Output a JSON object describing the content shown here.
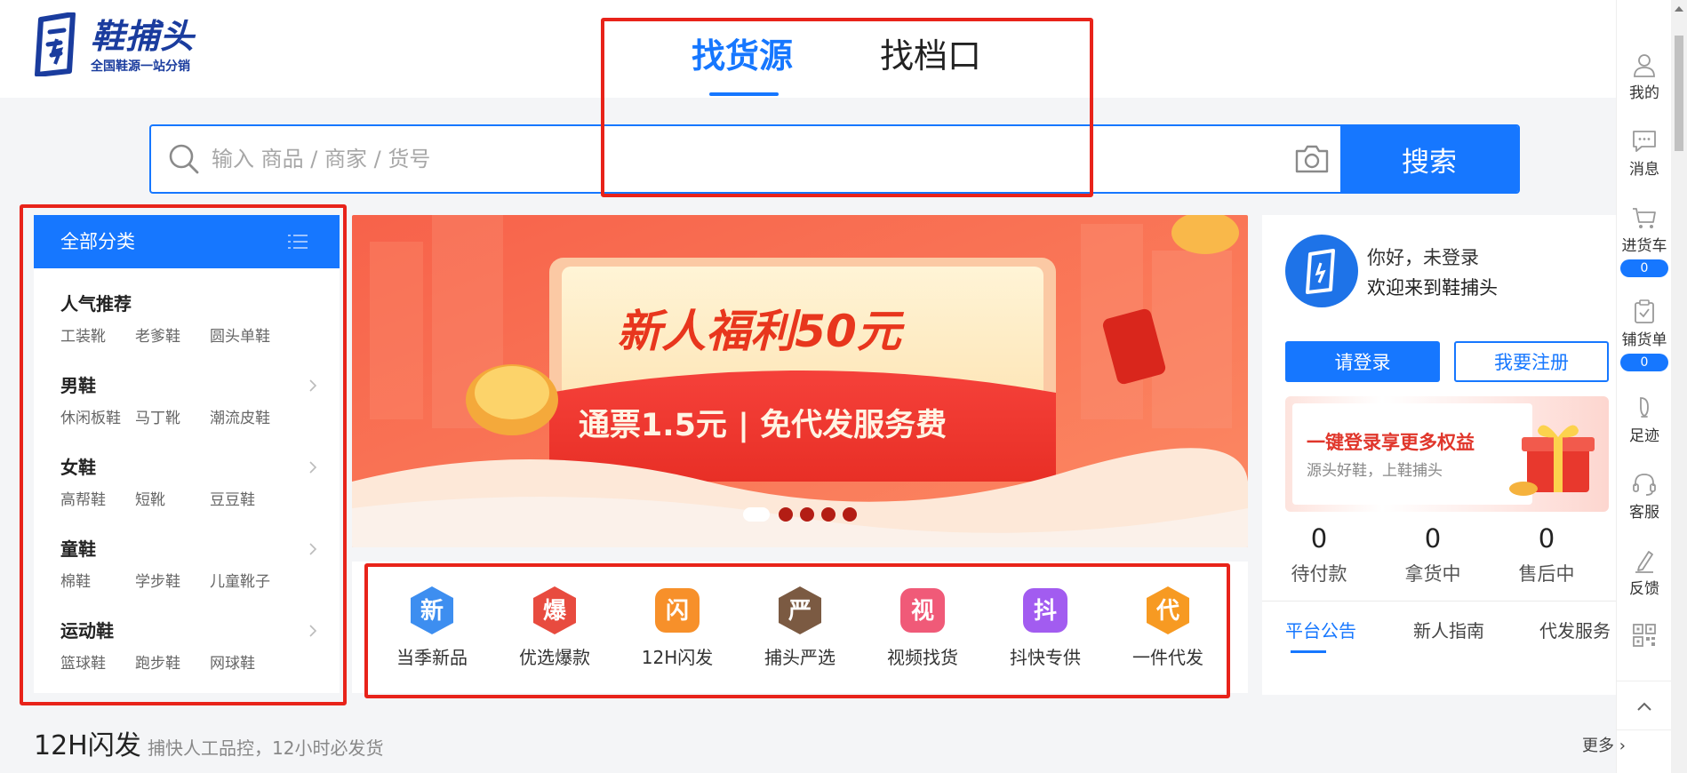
{
  "brand": {
    "name": "鞋捕头",
    "tagline": "全国鞋源一站分销",
    "primary_color": "#1677ff",
    "logo_color": "#1a3c9e"
  },
  "top_tabs": [
    {
      "label": "找货源",
      "active": true
    },
    {
      "label": "找档口",
      "active": false
    }
  ],
  "search": {
    "placeholder": "输入 商品 / 商家 / 货号",
    "value": "",
    "button_label": "搜索"
  },
  "categories": {
    "header": "全部分类",
    "groups": [
      {
        "title": "人气推荐",
        "items": [
          "工装靴",
          "老爹鞋",
          "圆头单鞋"
        ],
        "has_arrow": false
      },
      {
        "title": "男鞋",
        "items": [
          "休闲板鞋",
          "马丁靴",
          "潮流皮鞋"
        ],
        "has_arrow": true
      },
      {
        "title": "女鞋",
        "items": [
          "高帮鞋",
          "短靴",
          "豆豆鞋"
        ],
        "has_arrow": true
      },
      {
        "title": "童鞋",
        "items": [
          "棉鞋",
          "学步鞋",
          "儿童靴子"
        ],
        "has_arrow": true
      },
      {
        "title": "运动鞋",
        "items": [
          "篮球鞋",
          "跑步鞋",
          "网球鞋"
        ],
        "has_arrow": true
      }
    ]
  },
  "banner": {
    "headline": "新人福利50元",
    "subline": "通票1.5元  |  免代发服务费",
    "slide_count": 5,
    "active_slide": 1
  },
  "quick_entries": [
    {
      "label": "当季新品",
      "glyph": "新",
      "icon": "new-arrivals-icon",
      "color": "#3d8ef0"
    },
    {
      "label": "优选爆款",
      "glyph": "爆",
      "icon": "hot-picks-icon",
      "color": "#e84b3f"
    },
    {
      "label": "12H闪发",
      "glyph": "闪",
      "icon": "flash-ship-icon",
      "color": "#f7902a"
    },
    {
      "label": "捕头严选",
      "glyph": "严",
      "icon": "strict-select-icon",
      "color": "#7b5a42"
    },
    {
      "label": "视频找货",
      "glyph": "视",
      "icon": "video-search-icon",
      "color": "#f05a78"
    },
    {
      "label": "抖快专供",
      "glyph": "抖",
      "icon": "douyin-supply-icon",
      "color": "#a25cf0"
    },
    {
      "label": "一件代发",
      "glyph": "代",
      "icon": "dropship-icon",
      "color": "#f79a22"
    }
  ],
  "user_panel": {
    "greeting": "你好，未登录",
    "welcome": "欢迎来到鞋捕头",
    "login_label": "请登录",
    "register_label": "我要注册",
    "promo_title": "一键登录享更多权益",
    "promo_sub": "源头好鞋，上鞋捕头",
    "stats": [
      {
        "value": "0",
        "label": "待付款"
      },
      {
        "value": "0",
        "label": "拿货中"
      },
      {
        "value": "0",
        "label": "售后中"
      }
    ],
    "notice_tabs": [
      {
        "label": "平台公告",
        "active": true
      },
      {
        "label": "新人指南",
        "active": false
      },
      {
        "label": "代发服务",
        "active": false
      }
    ]
  },
  "toolbar": [
    {
      "label": "我的",
      "icon": "user-icon"
    },
    {
      "label": "消息",
      "icon": "message-icon"
    },
    {
      "label": "进货车",
      "icon": "cart-icon",
      "badge": "0"
    },
    {
      "label": "铺货单",
      "icon": "clipboard-icon",
      "badge": "0"
    },
    {
      "label": "足迹",
      "icon": "footprint-icon"
    },
    {
      "label": "客服",
      "icon": "headset-icon"
    },
    {
      "label": "反馈",
      "icon": "feedback-pen-icon"
    },
    {
      "label": "",
      "icon": "qr-code-icon"
    }
  ],
  "section": {
    "title": "12H闪发",
    "subtitle": "捕快人工品控，12小时必发货",
    "more_label": "更多 ›"
  },
  "annotation_color": "#e8231a"
}
